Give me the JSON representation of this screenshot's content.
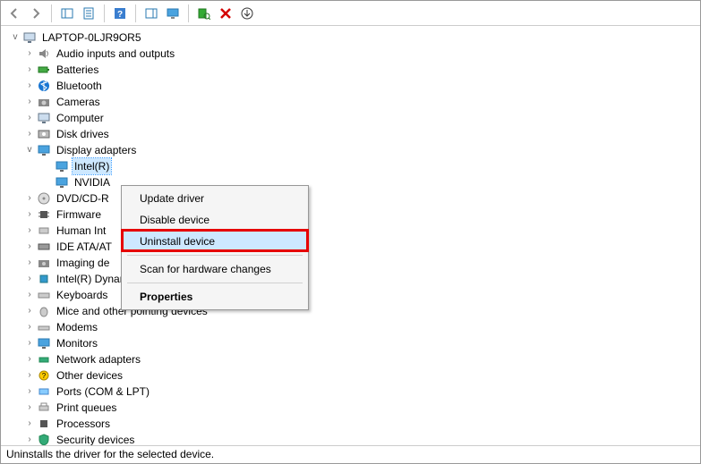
{
  "toolbar": {
    "back": "Back",
    "forward": "Forward",
    "show_hidden": "Show hidden devices",
    "properties": "Properties",
    "help": "Help",
    "action": "Action",
    "monitor": "View",
    "scan": "Scan for hardware changes",
    "remove": "Uninstall",
    "update": "Update"
  },
  "root": {
    "name": "LAPTOP-0LJR9OR5"
  },
  "categories": [
    {
      "label": "Audio inputs and outputs",
      "expanded": false
    },
    {
      "label": "Batteries",
      "expanded": false
    },
    {
      "label": "Bluetooth",
      "expanded": false
    },
    {
      "label": "Cameras",
      "expanded": false
    },
    {
      "label": "Computer",
      "expanded": false
    },
    {
      "label": "Disk drives",
      "expanded": false
    },
    {
      "label": "Display adapters",
      "expanded": true,
      "children": [
        {
          "label": "Intel(R)"
        },
        {
          "label": "NVIDIA"
        }
      ]
    },
    {
      "label": "DVD/CD-R",
      "expanded": false
    },
    {
      "label": "Firmware",
      "expanded": false
    },
    {
      "label": "Human Int",
      "expanded": false
    },
    {
      "label": "IDE ATA/AT",
      "expanded": false
    },
    {
      "label": "Imaging de",
      "expanded": false
    },
    {
      "label": "Intel(R) Dynamic Platform and Thermal Framework",
      "expanded": false
    },
    {
      "label": "Keyboards",
      "expanded": false
    },
    {
      "label": "Mice and other pointing devices",
      "expanded": false
    },
    {
      "label": "Modems",
      "expanded": false
    },
    {
      "label": "Monitors",
      "expanded": false
    },
    {
      "label": "Network adapters",
      "expanded": false
    },
    {
      "label": "Other devices",
      "expanded": false
    },
    {
      "label": "Ports (COM & LPT)",
      "expanded": false
    },
    {
      "label": "Print queues",
      "expanded": false
    },
    {
      "label": "Processors",
      "expanded": false
    },
    {
      "label": "Security devices",
      "expanded": false
    }
  ],
  "context_menu": {
    "update_driver": "Update driver",
    "disable_device": "Disable device",
    "uninstall_device": "Uninstall device",
    "scan": "Scan for hardware changes",
    "properties": "Properties"
  },
  "statusbar": {
    "text": "Uninstalls the driver for the selected device."
  }
}
